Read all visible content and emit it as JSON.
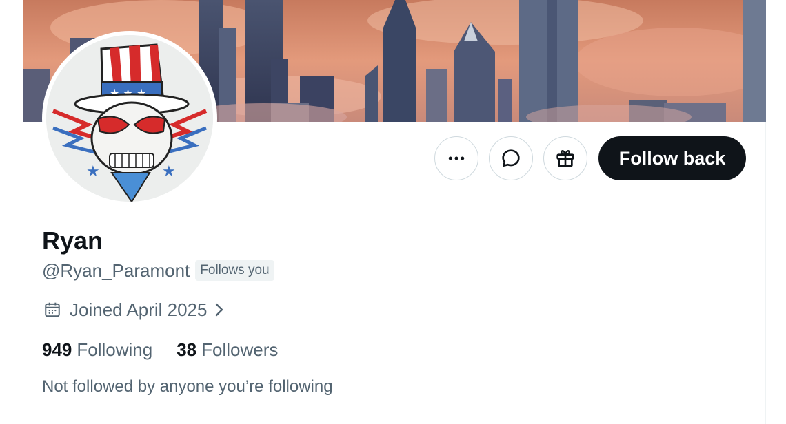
{
  "profile": {
    "name": "Ryan",
    "handle": "@Ryan_Paramont",
    "follows_you_badge": "Follows you",
    "joined": "Joined April 2025",
    "following_count": "949",
    "following_label": "Following",
    "followers_count": "38",
    "followers_label": "Followers",
    "mutuals_note": "Not followed by anyone you’re following"
  },
  "actions": {
    "follow_back_label": "Follow back",
    "more_icon": "ellipsis-icon",
    "message_icon": "chat-bubble-icon",
    "gift_icon": "gift-icon"
  },
  "colors": {
    "primary_text": "#0f1419",
    "secondary_text": "#536471",
    "follow_button_bg": "#0f1419",
    "border": "#cfd9de"
  }
}
